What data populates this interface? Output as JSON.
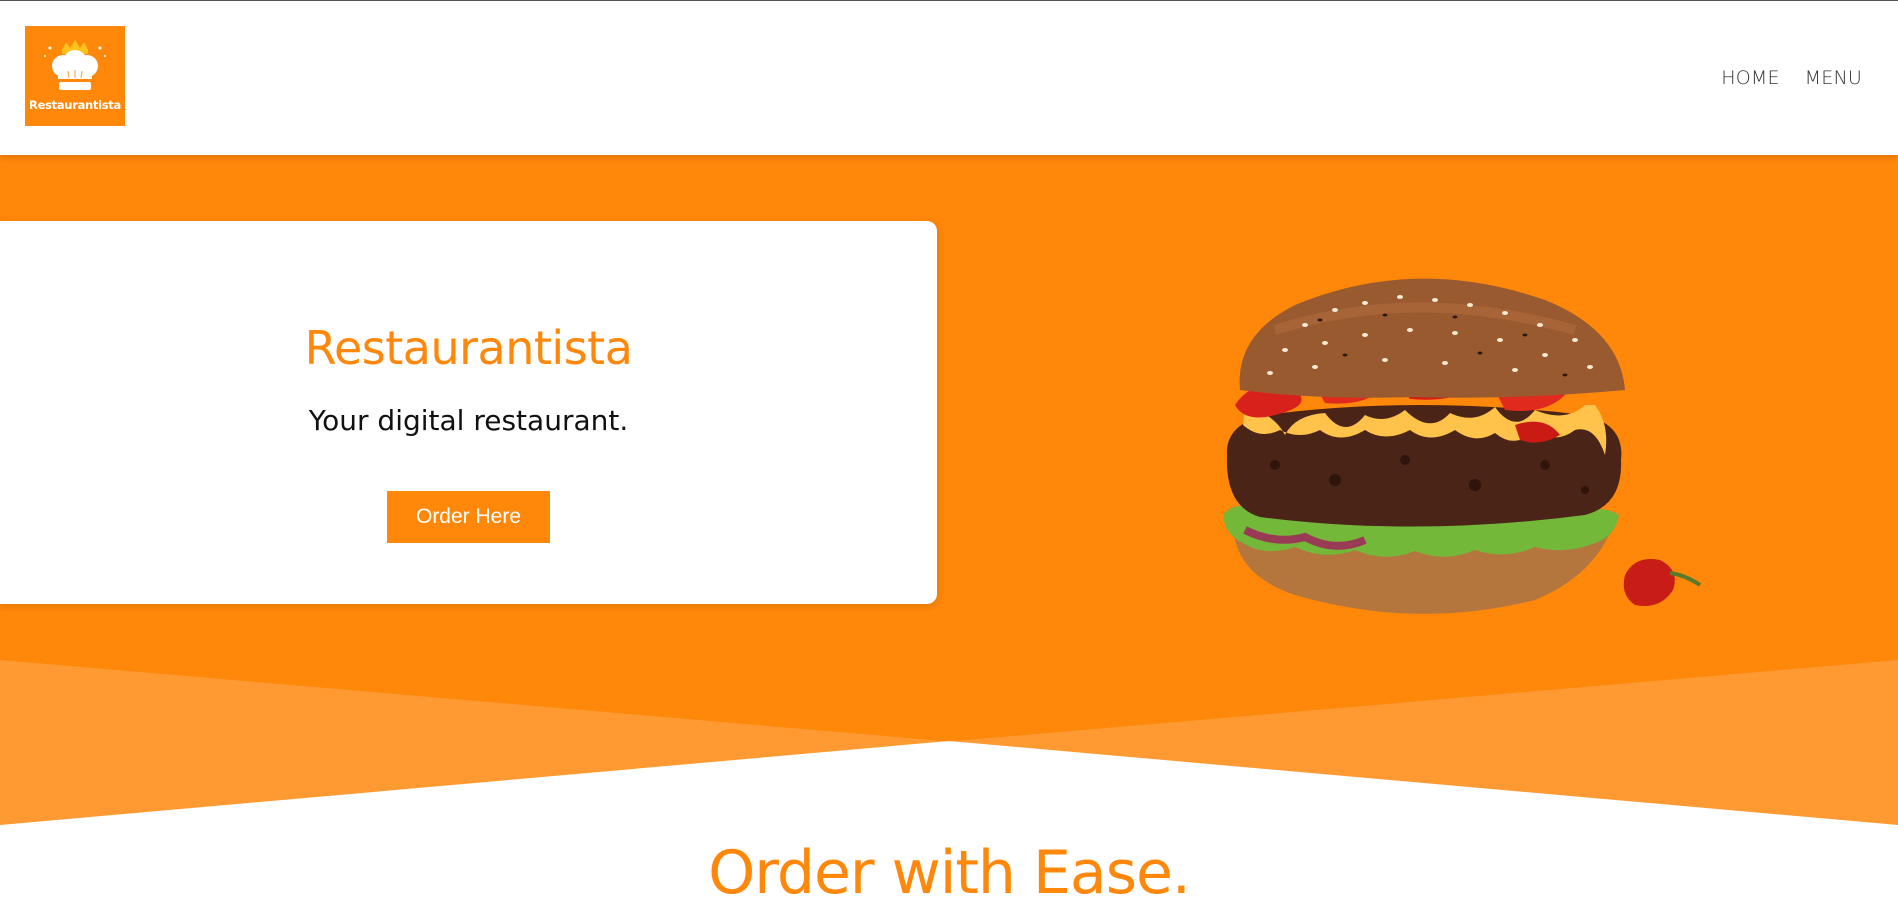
{
  "brand": {
    "logo_text": "Restaurantista"
  },
  "nav": {
    "items": [
      {
        "label": "HOME"
      },
      {
        "label": "MENU"
      }
    ]
  },
  "hero": {
    "title": "Restaurantista",
    "subtitle": "Your digital restaurant.",
    "cta_label": "Order Here"
  },
  "section": {
    "title": "Order with Ease."
  },
  "colors": {
    "accent": "#ff870a",
    "accent_light": "#ff9a33",
    "text": "#111111",
    "nav_text": "#333333"
  },
  "icons": {
    "logo": "chef-hat-with-crown",
    "hero_image": "burger"
  }
}
